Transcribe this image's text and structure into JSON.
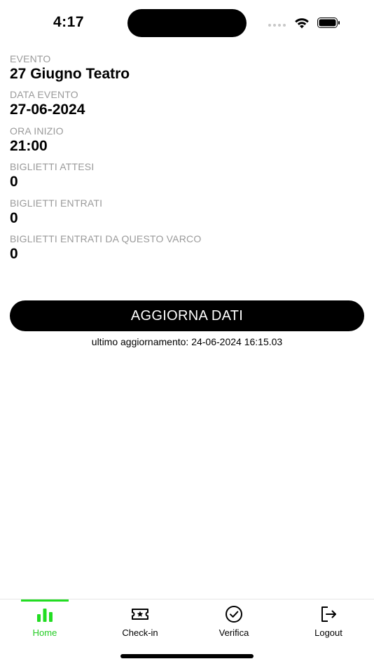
{
  "status_bar": {
    "time": "4:17"
  },
  "fields": [
    {
      "label": "EVENTO",
      "value": "27 Giugno Teatro"
    },
    {
      "label": "DATA EVENTO",
      "value": "27-06-2024"
    },
    {
      "label": "ORA INIZIO",
      "value": "21:00"
    },
    {
      "label": "BIGLIETTI ATTESI",
      "value": "0"
    },
    {
      "label": "BIGLIETTI ENTRATI",
      "value": "0"
    },
    {
      "label": "BIGLIETTI ENTRATI DA QUESTO VARCO",
      "value": "0"
    }
  ],
  "refresh_button": {
    "label": "AGGIORNA DATI"
  },
  "last_update": "ultimo aggiornamento: 24-06-2024 16:15.03",
  "tabs": [
    {
      "label": "Home",
      "icon": "bar-chart-icon",
      "active": true
    },
    {
      "label": "Check-in",
      "icon": "ticket-icon",
      "active": false
    },
    {
      "label": "Verifica",
      "icon": "check-circle-icon",
      "active": false
    },
    {
      "label": "Logout",
      "icon": "logout-icon",
      "active": false
    }
  ],
  "colors": {
    "accent": "#22cc22",
    "label_gray": "#9a9a9a",
    "button_bg": "#000000"
  }
}
